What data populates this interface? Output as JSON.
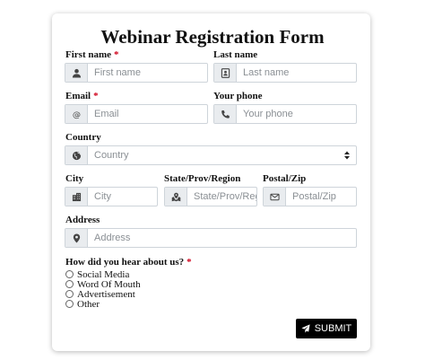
{
  "form": {
    "title": "Webinar Registration Form",
    "required_marker": "*",
    "fields": {
      "first_name": {
        "label": "First name",
        "placeholder": "First name",
        "icon": "user-icon"
      },
      "last_name": {
        "label": "Last name",
        "placeholder": "Last name",
        "icon": "id-card-icon"
      },
      "email": {
        "label": "Email",
        "placeholder": "Email",
        "icon": "at-icon"
      },
      "phone": {
        "label": "Your phone",
        "placeholder": "Your phone",
        "icon": "phone-icon"
      },
      "country": {
        "label": "Country",
        "selected": "Country",
        "icon": "globe-icon"
      },
      "city": {
        "label": "City",
        "placeholder": "City",
        "icon": "building-icon"
      },
      "state": {
        "label": "State/Prov/Region",
        "placeholder": "State/Prov/Reg",
        "icon": "map-icon"
      },
      "postal": {
        "label": "Postal/Zip",
        "placeholder": "Postal/Zip",
        "icon": "envelope-icon"
      },
      "address": {
        "label": "Address",
        "placeholder": "Address",
        "icon": "map-marker-icon"
      }
    },
    "hear_about": {
      "label": "How did you hear about us?",
      "options": [
        "Social Media",
        "Word Of Mouth",
        "Advertisement",
        "Other"
      ]
    },
    "submit_label": "SUBMIT",
    "colors": {
      "required": "#d0021b",
      "submit_bg": "#000000",
      "addon_bg": "#e9ecef",
      "border": "#ced4da"
    }
  }
}
